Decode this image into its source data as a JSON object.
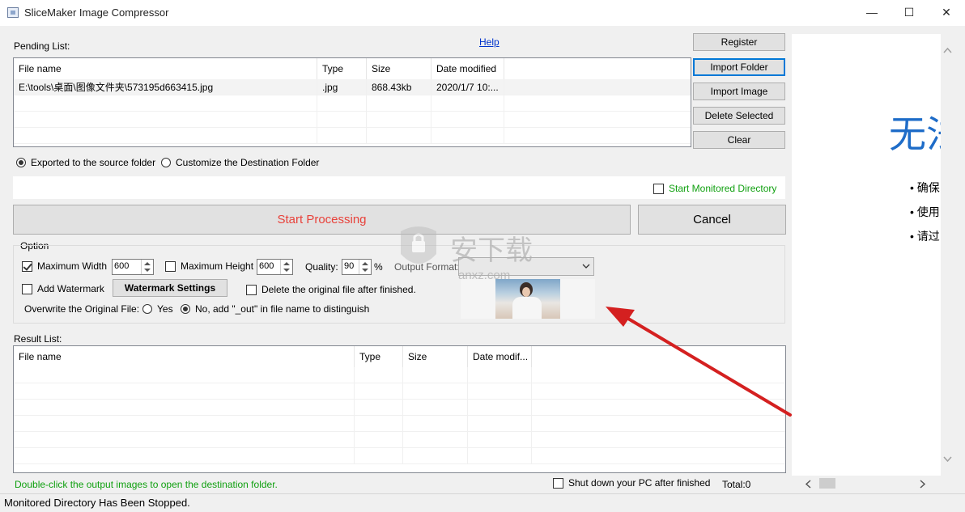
{
  "window": {
    "title": "SliceMaker Image Compressor",
    "minimize": "—",
    "maximize": "☐",
    "close": "✕"
  },
  "pending": {
    "label": "Pending List:",
    "help": "Help",
    "columns": [
      "File name",
      "Type",
      "Size",
      "Date modified"
    ],
    "rows": [
      [
        "E:\\tools\\桌面\\图像文件夹\\573195d663415.jpg",
        ".jpg",
        "868.43kb",
        "2020/1/7 10:..."
      ]
    ]
  },
  "side_buttons": {
    "register": "Register",
    "import_folder": "Import Folder",
    "import_image": "Import Image",
    "delete_selected": "Delete Selected",
    "clear": "Clear"
  },
  "destination": {
    "source": "Exported to the source folder",
    "custom": "Customize the Destination Folder",
    "selected": "source"
  },
  "monitor": {
    "label": "Start Monitored Directory",
    "checked": false
  },
  "actions": {
    "start": "Start Processing",
    "cancel": "Cancel"
  },
  "option": {
    "group_label": "Option",
    "max_width_label": "Maximum Width",
    "max_width_checked": true,
    "max_width": "600",
    "max_height_label": "Maximum Height",
    "max_height_checked": false,
    "max_height": "600",
    "quality_label": "Quality:",
    "quality": "90",
    "percent": "%",
    "output_format_label": "Output Format:",
    "output_format": "",
    "add_watermark": "Add Watermark",
    "add_watermark_checked": false,
    "watermark_settings": "Watermark Settings",
    "delete_original": "Delete the original file after finished.",
    "delete_original_checked": false,
    "overwrite_label": "Overwrite the Original File:",
    "overwrite_yes": "Yes",
    "overwrite_no": "No, add \"_out\" in file name to distinguish",
    "overwrite_selected": "no"
  },
  "result": {
    "label": "Result List:",
    "columns": [
      "File name",
      "Type",
      "Size",
      "Date modif..."
    ],
    "rows": []
  },
  "footer": {
    "hint": "Double-click the output images to open the destination folder.",
    "shutdown": "Shut down your PC after finished",
    "total": "Total:0"
  },
  "status": "Monitored Directory Has Been Stopped.",
  "side_doc": {
    "heading": "无法",
    "bullets": [
      "确保",
      "使用",
      "请过"
    ]
  },
  "watermark_overlay": {
    "site": "安下载",
    "domain": "anxz.com"
  },
  "colors": {
    "accent": "#0078d7",
    "green": "#10a010",
    "start_text": "#e8413a",
    "heading_blue": "#1e6cc8",
    "arrow": "#d42020"
  }
}
